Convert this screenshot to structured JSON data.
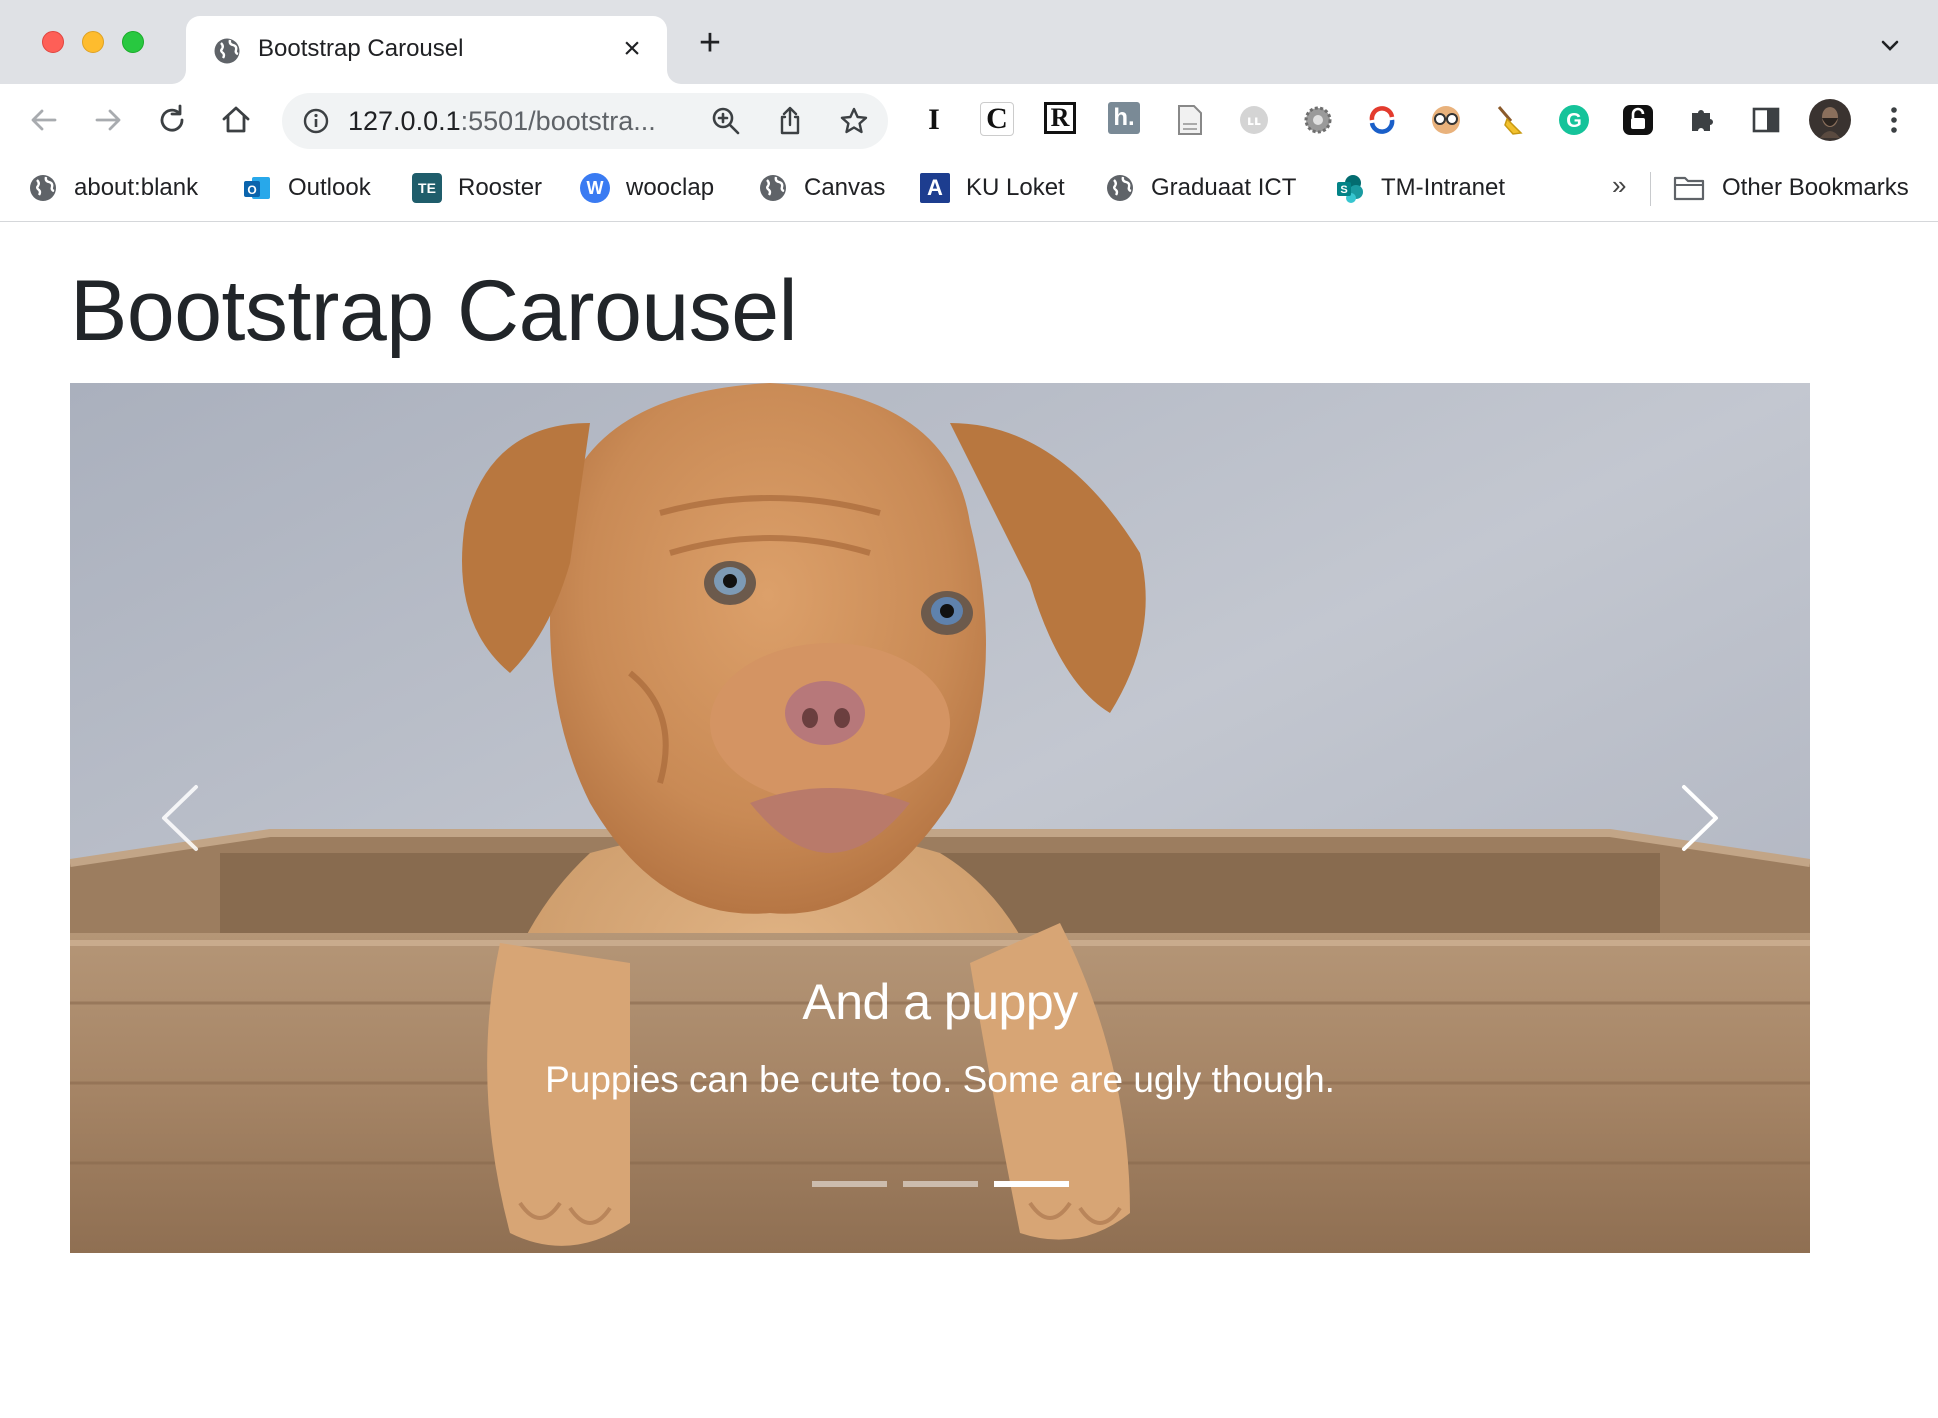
{
  "window": {
    "tab_title": "Bootstrap Carousel",
    "new_tab_symbol": "+"
  },
  "toolbar": {
    "url_host": "127.0.0.1",
    "url_rest": ":5501/bootstra...",
    "extensions": [
      "I",
      "C",
      "R",
      "h.",
      "doc-icon",
      "ublock-icon",
      "gear-icon",
      "sync-icon",
      "glasses-icon",
      "broom-icon",
      "G",
      "lock-icon",
      "puzzle-icon",
      "sidepanel-icon",
      "avatar"
    ]
  },
  "bookmarks": {
    "items": [
      {
        "label": "about:blank",
        "icon": "globe-icon"
      },
      {
        "label": "Outlook",
        "icon": "outlook-icon",
        "color": "#0a64ad"
      },
      {
        "label": "Rooster",
        "icon": "TE",
        "color": "#1f5d6b"
      },
      {
        "label": "wooclap",
        "icon": "W",
        "color": "#3a7bf2"
      },
      {
        "label": "Canvas",
        "icon": "globe-icon"
      },
      {
        "label": "KU Loket",
        "icon": "A",
        "color": "#1d3d8f"
      },
      {
        "label": "Graduaat ICT",
        "icon": "globe-icon"
      },
      {
        "label": "TM-Intranet",
        "icon": "S",
        "color": "#038387"
      }
    ],
    "more": "»",
    "other": "Other Bookmarks"
  },
  "page": {
    "title": "Bootstrap Carousel"
  },
  "carousel": {
    "caption_title": "And a puppy",
    "caption_text": "Puppies can be cute too. Some are ugly though.",
    "slide_count": 3,
    "active_slide": 3
  }
}
